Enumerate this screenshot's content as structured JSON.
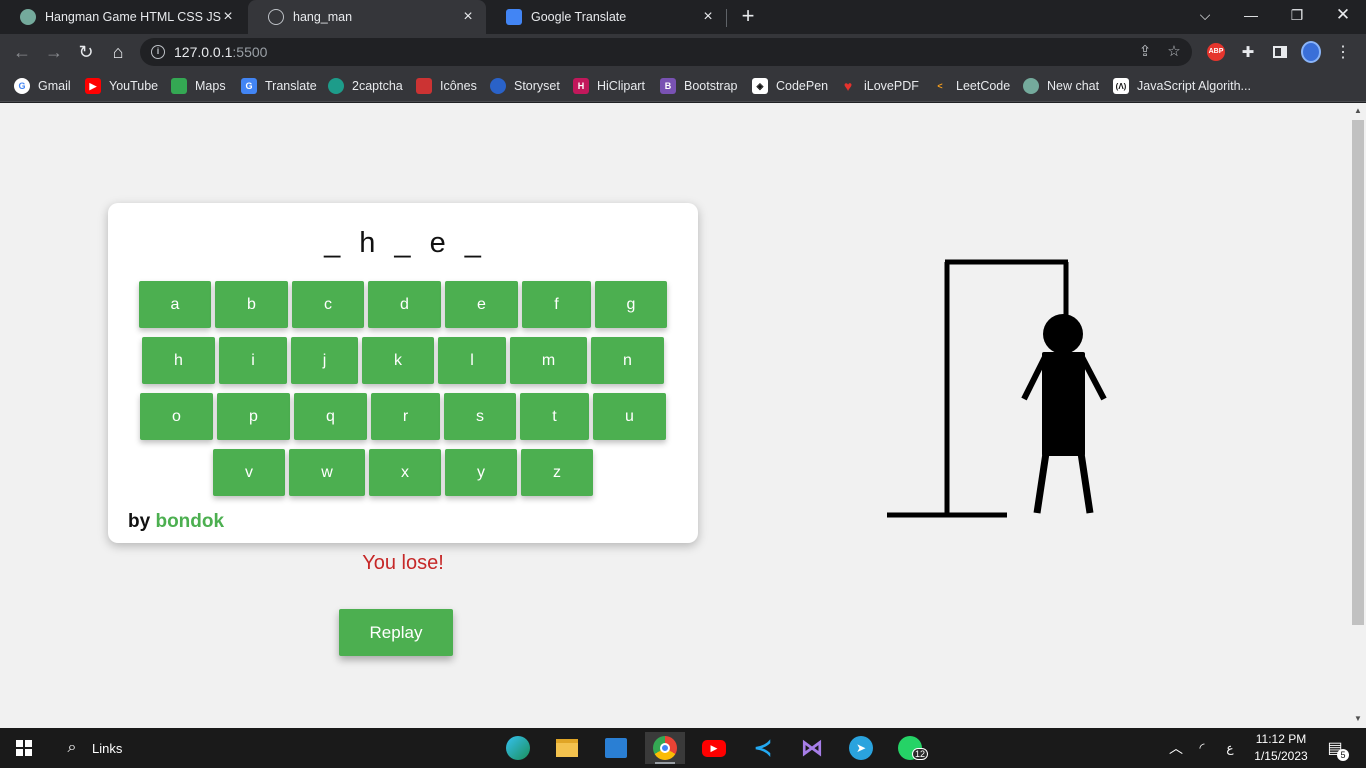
{
  "browser": {
    "tabs": [
      {
        "title": "Hangman Game HTML CSS JS",
        "icon": "chatgpt-icon"
      },
      {
        "title": "hang_man",
        "icon": "globe-icon"
      },
      {
        "title": "Google Translate",
        "icon": "google-translate-icon"
      }
    ],
    "new_tab_label": "+",
    "url_host": "127.0.0.1",
    "url_port": ":5500",
    "bookmarks": [
      {
        "label": "Gmail",
        "icon": "google-icon"
      },
      {
        "label": "YouTube",
        "icon": "youtube-icon"
      },
      {
        "label": "Maps",
        "icon": "maps-icon"
      },
      {
        "label": "Translate",
        "icon": "google-translate-icon"
      },
      {
        "label": "2captcha",
        "icon": "2captcha-icon"
      },
      {
        "label": "Icônes",
        "icon": "icones-icon"
      },
      {
        "label": "Storyset",
        "icon": "storyset-icon"
      },
      {
        "label": "HiClipart",
        "icon": "hiclipart-icon"
      },
      {
        "label": "Bootstrap",
        "icon": "bootstrap-icon"
      },
      {
        "label": "CodePen",
        "icon": "codepen-icon"
      },
      {
        "label": "iLovePDF",
        "icon": "ilovepdf-icon"
      },
      {
        "label": "LeetCode",
        "icon": "leetcode-icon"
      },
      {
        "label": "New chat",
        "icon": "chatgpt-icon"
      },
      {
        "label": "JavaScript Algorith...",
        "icon": "freecodecamp-icon"
      }
    ],
    "extension_abp": "ABP"
  },
  "game": {
    "word_slots": [
      "_",
      "h",
      "_",
      "e",
      "_"
    ],
    "keyboard_rows": [
      [
        "a",
        "b",
        "c",
        "d",
        "e",
        "f",
        "g"
      ],
      [
        "h",
        "i",
        "j",
        "k",
        "l",
        "m",
        "n"
      ],
      [
        "o",
        "p",
        "q",
        "r",
        "s",
        "t",
        "u"
      ],
      [
        "v",
        "w",
        "x",
        "y",
        "z"
      ]
    ],
    "byline_prefix": "by",
    "author": "bondok",
    "result_text": "You lose!",
    "replay_label": "Replay",
    "colors": {
      "key": "#4caf50",
      "lose": "#c62828",
      "author": "#4caf50"
    }
  },
  "taskbar": {
    "search_label": "Links",
    "apps": [
      "edge-icon",
      "file-explorer-icon",
      "store-icon",
      "chrome-icon",
      "youtube-icon",
      "vscode-icon",
      "visual-studio-icon",
      "telegram-icon",
      "whatsapp-icon"
    ],
    "whatsapp_badge": "12",
    "tray_lang": "ع",
    "time": "11:12 PM",
    "date": "1/15/2023",
    "notification_count": "5"
  }
}
